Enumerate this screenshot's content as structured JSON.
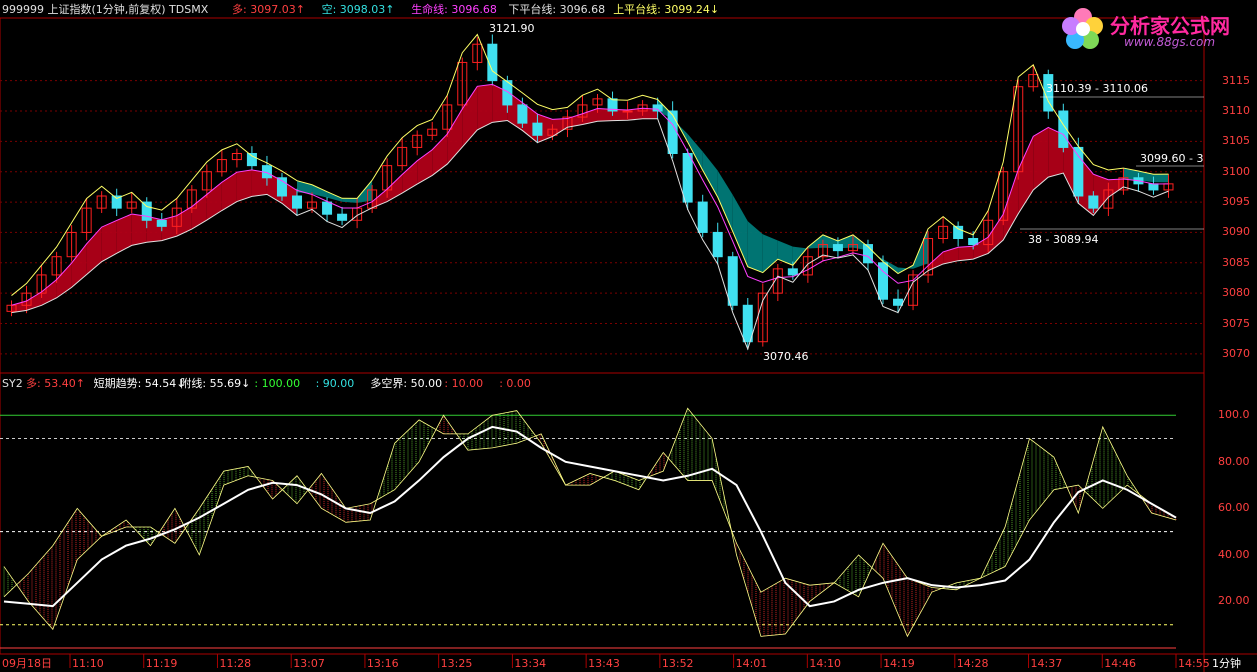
{
  "header": {
    "title": "999999 上证指数(1分钟,前复权) TDSMX",
    "items": [
      {
        "label": "多:",
        "value": "3097.03",
        "arrow": "↑",
        "color": "#ff4040"
      },
      {
        "label": "空:",
        "value": "3098.03",
        "arrow": "↑",
        "color": "#33e0e0"
      },
      {
        "label": "生命线:",
        "value": "3096.68",
        "arrow": "",
        "color": "#ff40ff"
      },
      {
        "label": "下平台线:",
        "value": "3096.68",
        "arrow": "",
        "color": "#e0e0e0"
      },
      {
        "label": "上平台线:",
        "value": "3099.24",
        "arrow": "↓",
        "color": "#ffff66"
      }
    ]
  },
  "logo": {
    "title": "分析家公式网",
    "url": "www.88gs.com"
  },
  "main_annotations": {
    "high": "3121.90",
    "low": "3070.46",
    "upper_range": "3110.39 - 3110.06",
    "right_range": "3099.60 - 3",
    "lower_range": "38 - 3089.94"
  },
  "sub_header": {
    "name": "SY2",
    "items": [
      {
        "text": "多: 53.40",
        "arrow": "↑",
        "color": "#ff4040"
      },
      {
        "text": "短期趋势: 54.54",
        "arrow": "↓",
        "color": "#ffffff"
      },
      {
        "text": "附线: 55.69",
        "arrow": "↓",
        "color": "#ffffff"
      },
      {
        "text": ": 100.00",
        "arrow": "",
        "color": "#33ff33"
      },
      {
        "text": ": 90.00",
        "arrow": "",
        "color": "#33e0e0"
      },
      {
        "text": "多空界: 50.00",
        "arrow": "",
        "color": "#ffffff"
      },
      {
        "text": ": 10.00",
        "arrow": "",
        "color": "#ff4040"
      },
      {
        "text": ": 0.00",
        "arrow": "",
        "color": "#ff4040"
      }
    ]
  },
  "price_axis": [
    "3115",
    "3110",
    "3105",
    "3100",
    "3095",
    "3090",
    "3085",
    "3080",
    "3075",
    "3070"
  ],
  "osc_axis": [
    "100.0",
    "80.00",
    "60.00",
    "40.00",
    "20.00"
  ],
  "time_axis": [
    "09月18日",
    "11:10",
    "11:19",
    "11:28",
    "13:07",
    "13:16",
    "13:25",
    "13:34",
    "13:43",
    "13:52",
    "14:01",
    "14:10",
    "14:19",
    "14:28",
    "14:37",
    "14:46",
    "14:55"
  ],
  "period": "1分钟",
  "colors": {
    "bull": "#ff2020",
    "bear": "#40e0f0",
    "cloud_teal": "#007a78",
    "cloud_red": "#b00018",
    "grid": "#7a0000"
  },
  "chart_data": {
    "type": "candlestick",
    "price_series": [
      3078,
      3080,
      3083,
      3086,
      3090,
      3094,
      3096,
      3094,
      3095,
      3092,
      3091,
      3094,
      3097,
      3100,
      3102,
      3103,
      3101,
      3099,
      3096,
      3094,
      3095,
      3093,
      3092,
      3094,
      3097,
      3101,
      3104,
      3106,
      3107,
      3111,
      3118,
      3121,
      3115,
      3111,
      3108,
      3106,
      3107,
      3109,
      3111,
      3112,
      3110,
      3110,
      3111,
      3110,
      3103,
      3095,
      3090,
      3086,
      3078,
      3072,
      3080,
      3084,
      3083,
      3086,
      3088,
      3087,
      3088,
      3085,
      3079,
      3078,
      3083,
      3089,
      3091,
      3089,
      3088,
      3092,
      3100,
      3114,
      3116,
      3110,
      3104,
      3096,
      3094,
      3097,
      3099,
      3098,
      3097,
      3098
    ],
    "osc_series": [
      {
        "name": "短期趋势",
        "values": [
          20,
          19,
          18,
          28,
          38,
          44,
          47,
          51,
          56,
          62,
          68,
          71,
          70,
          66,
          60,
          58,
          63,
          72,
          82,
          90,
          95,
          93,
          86,
          80,
          78,
          76,
          74,
          72,
          74,
          77,
          70,
          50,
          28,
          18,
          20,
          25,
          28,
          30,
          27,
          26,
          27,
          29,
          38,
          54,
          67,
          72,
          68,
          62,
          56
        ]
      },
      {
        "name": "多",
        "values": [
          35,
          20,
          8,
          38,
          48,
          52,
          52,
          45,
          60,
          76,
          78,
          64,
          74,
          60,
          54,
          55,
          88,
          98,
          92,
          92,
          100,
          102,
          88,
          70,
          70,
          76,
          72,
          76,
          103,
          90,
          40,
          5,
          6,
          20,
          28,
          40,
          30,
          5,
          24,
          28,
          30,
          52,
          90,
          82,
          58,
          95,
          74,
          58,
          55
        ]
      },
      {
        "name": "附线",
        "values": [
          22,
          32,
          44,
          60,
          48,
          55,
          44,
          60,
          40,
          70,
          74,
          72,
          62,
          75,
          60,
          62,
          68,
          80,
          100,
          85,
          86,
          88,
          92,
          70,
          75,
          72,
          68,
          84,
          72,
          72,
          45,
          24,
          30,
          27,
          28,
          22,
          45,
          30,
          26,
          25,
          30,
          35,
          55,
          68,
          70,
          60,
          70,
          62,
          56
        ]
      }
    ],
    "levels": [
      100,
      90,
      50,
      10,
      0
    ],
    "ylim_price": [
      3068,
      3124
    ],
    "ylim_osc": [
      0,
      110
    ]
  }
}
